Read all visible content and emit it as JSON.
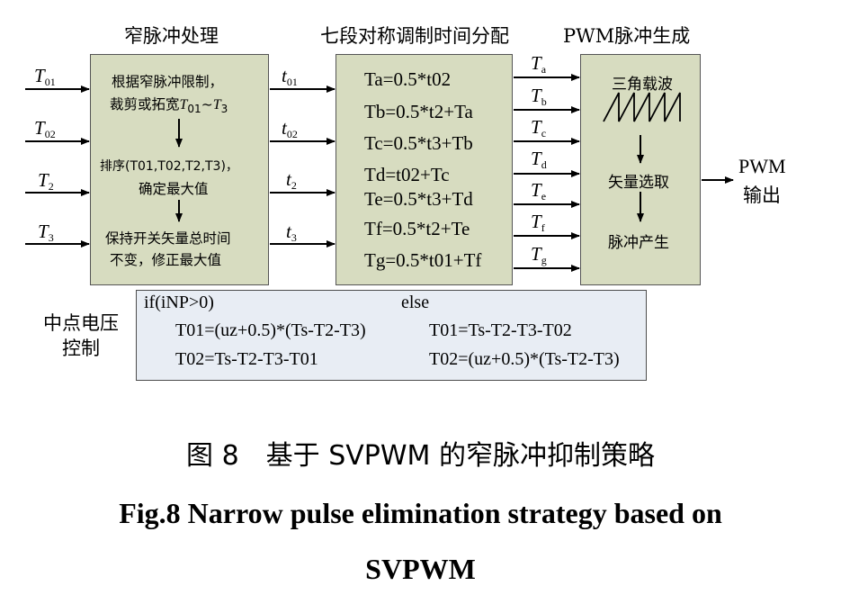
{
  "titles": {
    "narrow_pulse": "窄脉冲处理",
    "seven_segment": "七段对称调制时间分配",
    "pwm_gen": "PWM脉冲生成"
  },
  "inputs": {
    "t01": {
      "var": "T",
      "sub": "01"
    },
    "t02": {
      "var": "T",
      "sub": "02"
    },
    "t2": {
      "var": "T",
      "sub": "2"
    },
    "t3": {
      "var": "T",
      "sub": "3"
    }
  },
  "narrow_block": {
    "step1_line1": "根据窄脉冲限制，",
    "step1_line2_prefix": "裁剪或拓宽",
    "step1_line2_math": "T",
    "step1_sub_a": "01",
    "step1_tilde": "~",
    "step1_sub_b": "3",
    "step2_line1": "排序(T01,T02,T2,T3)，",
    "step2_line2": "确定最大值",
    "step3_line1": "保持开关矢量总时间",
    "step3_line2": "不变，修正最大值"
  },
  "mid_signals": {
    "s1": {
      "var": "t",
      "sub": "01"
    },
    "s2": {
      "var": "t",
      "sub": "02"
    },
    "s3": {
      "var": "t",
      "sub": "2"
    },
    "s4": {
      "var": "t",
      "sub": "3"
    }
  },
  "seven_block": {
    "equations": [
      "Ta=0.5*t02",
      "Tb=0.5*t2+Ta",
      "Tc=0.5*t3+Tb",
      "Td=t02+Tc",
      "Te=0.5*t3+Td",
      "Tf=0.5*t2+Te",
      "Tg=0.5*t01+Tf"
    ]
  },
  "times": [
    "a",
    "b",
    "c",
    "d",
    "e",
    "f",
    "g"
  ],
  "pwm_block": {
    "carrier": "三角载波",
    "select": "矢量选取",
    "generate": "脉冲产生"
  },
  "output": {
    "line1": "PWM",
    "line2": "输出"
  },
  "control": {
    "label_line1": "中点电压",
    "label_line2": "控制",
    "if_text": "if(iNP>0)",
    "else_text": "else",
    "if_eq1": "T01=(uz+0.5)*(Ts-T2-T3)",
    "if_eq2": "T02=Ts-T2-T3-T01",
    "else_eq1": "T01=Ts-T2-T3-T02",
    "else_eq2": "T02=(uz+0.5)*(Ts-T2-T3)"
  },
  "caption": {
    "cn": "图 8　基于 SVPWM 的窄脉冲抑制策略",
    "en_line1": "Fig.8    Narrow pulse elimination strategy based on",
    "en_line2": "SVPWM"
  }
}
